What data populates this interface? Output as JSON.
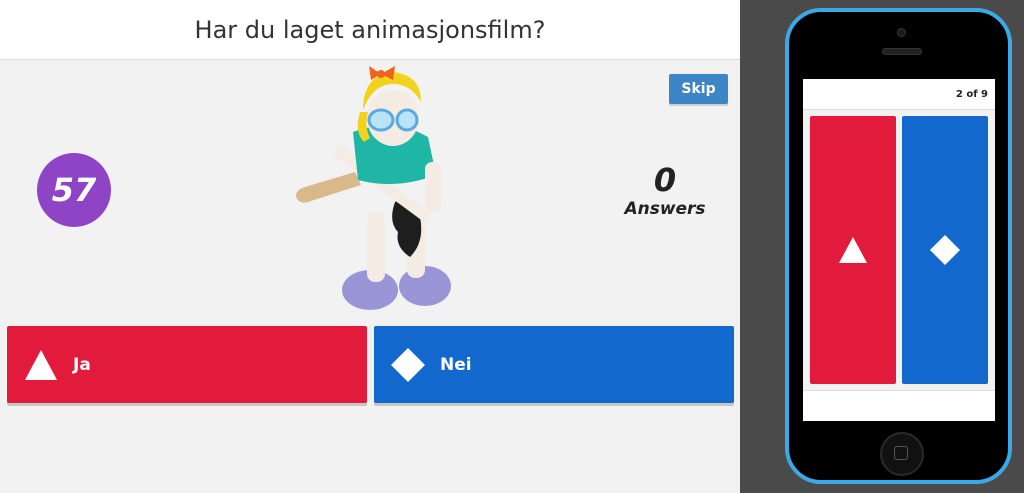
{
  "question": {
    "title": "Har du laget animasjonsfilm?"
  },
  "controls": {
    "skip_label": "Skip"
  },
  "timer": {
    "value": "57"
  },
  "answers_summary": {
    "count": "0",
    "label": "Answers"
  },
  "answers": [
    {
      "label": "Ja",
      "shape": "triangle",
      "color": "#e21b3c"
    },
    {
      "label": "Nei",
      "shape": "diamond",
      "color": "#1368ce"
    }
  ],
  "phone": {
    "progress": "2 of 9"
  },
  "colors": {
    "red": "#e21b3c",
    "blue": "#1368ce",
    "purple": "#8e44c4",
    "skip": "#3d86c6",
    "phone_frame": "#39a9e8"
  }
}
